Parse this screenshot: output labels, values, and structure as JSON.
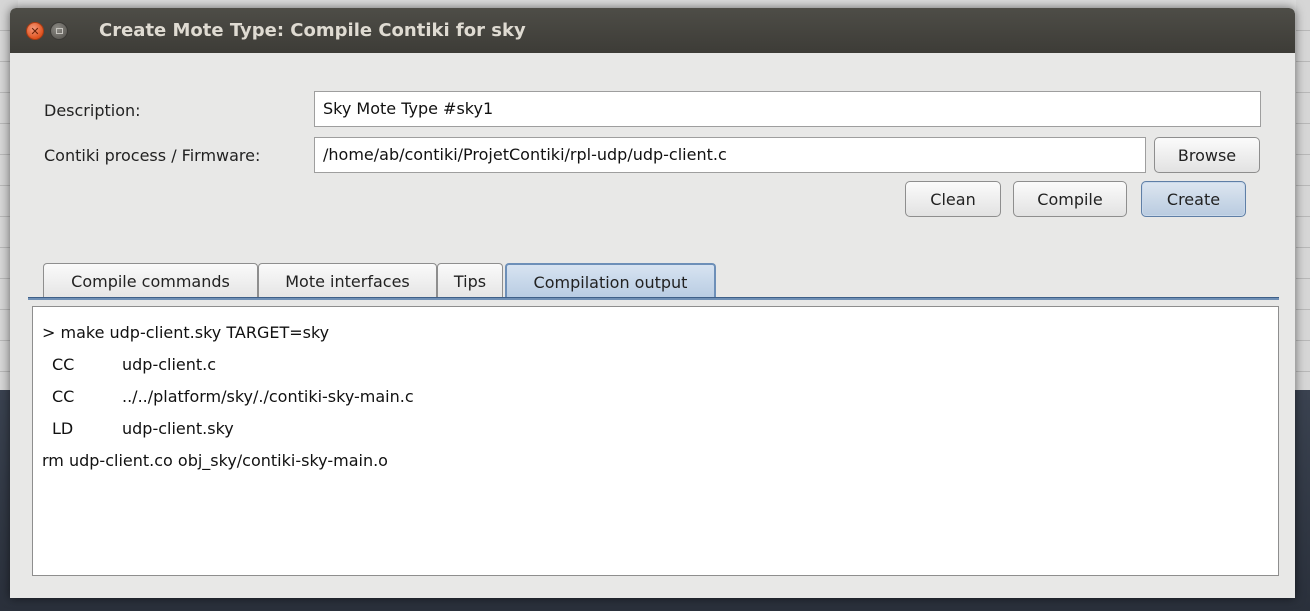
{
  "window": {
    "title": "Create Mote Type: Compile Contiki for sky"
  },
  "form": {
    "description_label": "Description:",
    "description_value": "Sky Mote Type #sky1",
    "firmware_label": "Contiki process / Firmware:",
    "firmware_value": "/home/ab/contiki/ProjetContiki/rpl-udp/udp-client.c"
  },
  "buttons": {
    "browse": "Browse",
    "clean": "Clean",
    "compile": "Compile",
    "create": "Create"
  },
  "tabs": [
    {
      "label": "Compile commands",
      "active": false
    },
    {
      "label": "Mote interfaces",
      "active": false
    },
    {
      "label": "Tips",
      "active": false
    },
    {
      "label": "Compilation output",
      "active": true
    }
  ],
  "output": {
    "command": "> make udp-client.sky TARGET=sky",
    "steps": [
      {
        "tool": "CC",
        "target": "udp-client.c"
      },
      {
        "tool": "CC",
        "target": "../../platform/sky/./contiki-sky-main.c"
      },
      {
        "tool": "LD",
        "target": "udp-client.sky"
      }
    ],
    "final": "rm udp-client.co obj_sky/contiki-sky-main.o"
  }
}
